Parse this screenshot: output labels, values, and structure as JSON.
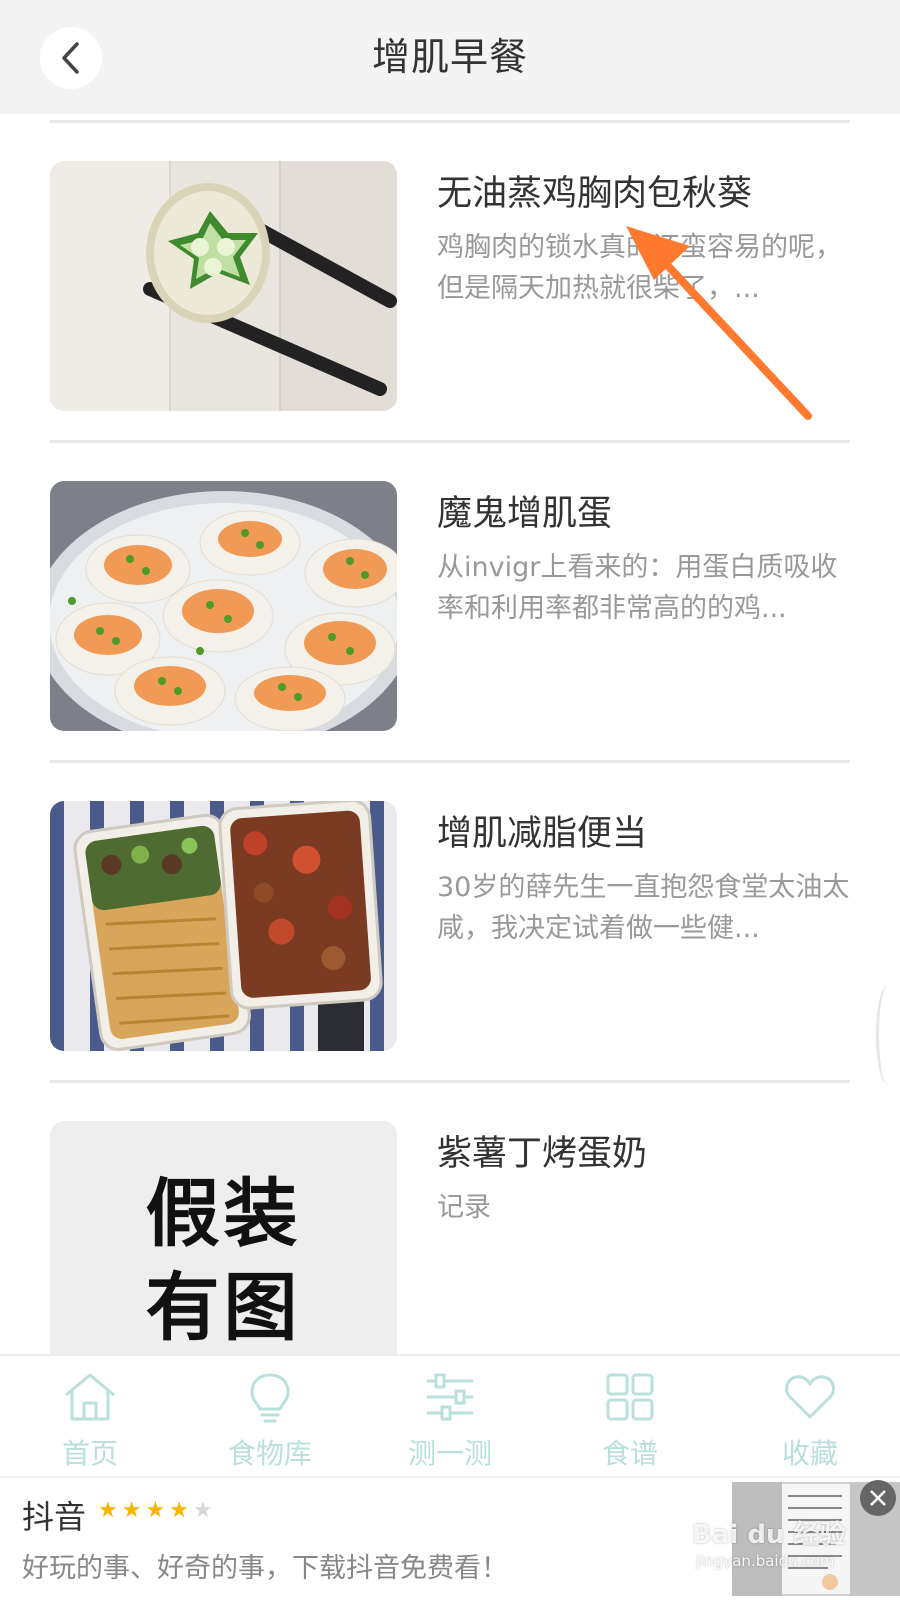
{
  "header": {
    "title": "增肌早餐",
    "back_icon": "chevron-left-icon"
  },
  "recipes": [
    {
      "title": "无油蒸鸡胸肉包秋葵",
      "desc": "鸡胸肉的锁水真的还蛮容易的呢，但是隔天加热就很柴了，...",
      "thumb": "okra-chicken-photo"
    },
    {
      "title": "魔鬼增肌蛋",
      "desc": "从invigr上看来的：用蛋白质吸收率和利用率都非常高的的鸡...",
      "thumb": "deviled-eggs-photo"
    },
    {
      "title": "增肌减脂便当",
      "desc": "30岁的薛先生一直抱怨食堂太油太咸，我决定试着做一些健...",
      "thumb": "bento-box-photo"
    },
    {
      "title": "紫薯丁烤蛋奶",
      "desc": "记录",
      "thumb": "placeholder-image",
      "thumb_line1": "假装",
      "thumb_line2": "有图"
    }
  ],
  "nav": [
    {
      "label": "首页",
      "icon": "home-icon"
    },
    {
      "label": "食物库",
      "icon": "lightbulb-icon"
    },
    {
      "label": "测一测",
      "icon": "sliders-icon"
    },
    {
      "label": "食谱",
      "icon": "grid-icon"
    },
    {
      "label": "收藏",
      "icon": "heart-icon"
    }
  ],
  "ad": {
    "title": "抖音",
    "rating": 4,
    "rating_max": 5,
    "desc": "好玩的事、好奇的事，下载抖音免费看！",
    "close_icon": "close-icon"
  },
  "watermark": {
    "text": "Bai du 经验",
    "sub": "jingyan.baidu.com"
  },
  "colors": {
    "accent": "#b9e0dc",
    "arrow": "#ff7a2f",
    "header_bg": "#f4f4f4"
  }
}
